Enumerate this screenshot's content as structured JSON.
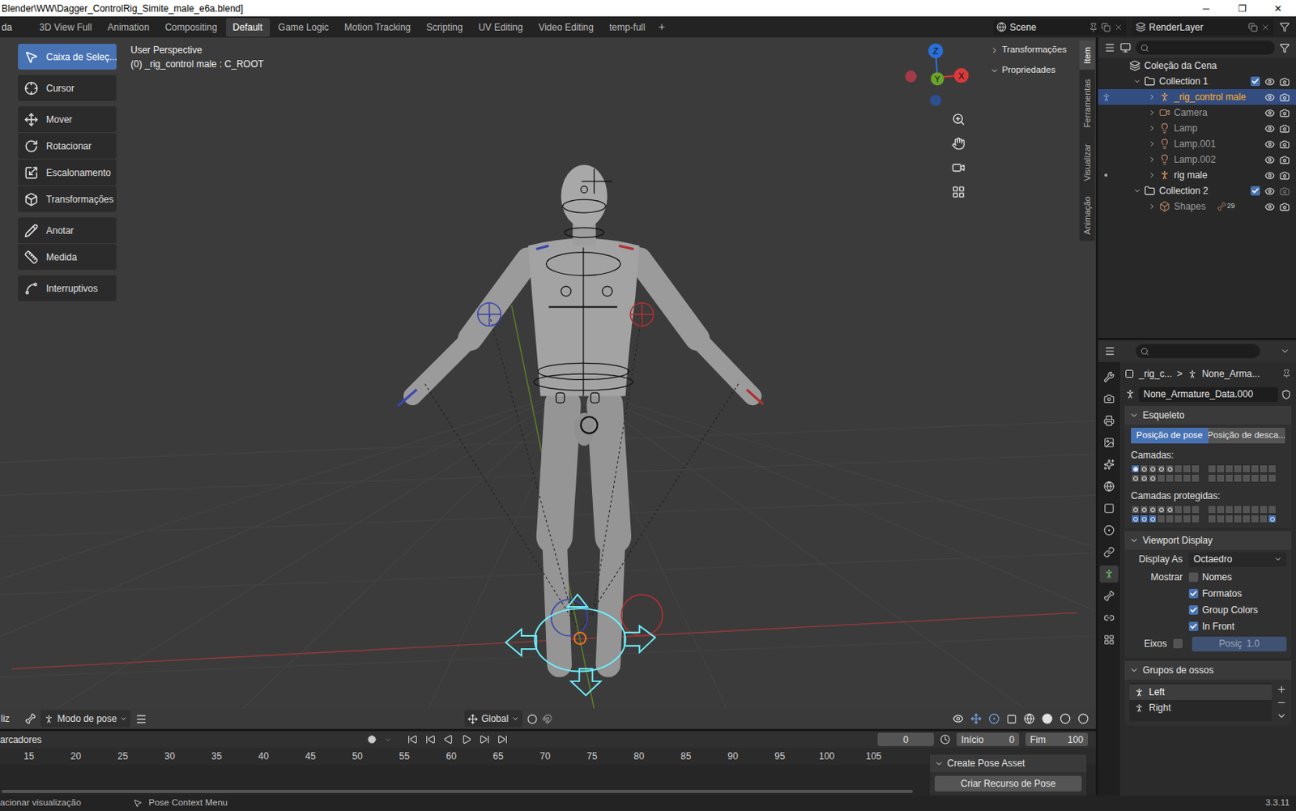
{
  "window": {
    "title": "Blender\\WW\\Dagger_ControlRig_Simite_male_e6a.blend]",
    "controls": [
      "─",
      "❐",
      "✕"
    ]
  },
  "menu_cut": "da",
  "workspaces": [
    {
      "label": "3D View Full",
      "selected": false
    },
    {
      "label": "Animation",
      "selected": false
    },
    {
      "label": "Compositing",
      "selected": false
    },
    {
      "label": "Default",
      "selected": true
    },
    {
      "label": "Game Logic",
      "selected": false
    },
    {
      "label": "Motion Tracking",
      "selected": false
    },
    {
      "label": "Scripting",
      "selected": false
    },
    {
      "label": "UV Editing",
      "selected": false
    },
    {
      "label": "Video Editing",
      "selected": false
    },
    {
      "label": "temp-full",
      "selected": false
    }
  ],
  "add_tab": "+",
  "scene": "Scene",
  "view_layer": "RenderLayer",
  "toolbar": [
    {
      "label": "Caixa de Seleç...",
      "selected": true
    },
    {
      "label": "Cursor",
      "selected": false
    },
    {
      "label": "Mover",
      "selected": false
    },
    {
      "label": "Rotacionar",
      "selected": false
    },
    {
      "label": "Escalonamento",
      "selected": false
    },
    {
      "label": "Transformações",
      "selected": false
    },
    {
      "label": "Anotar",
      "selected": false
    },
    {
      "label": "Medida",
      "selected": false
    },
    {
      "label": "Interruptivos",
      "selected": false
    }
  ],
  "viewport": {
    "view": "User Perspective",
    "object": "(0) _rig_control male : C_ROOT",
    "axes": {
      "x": "X",
      "y": "Y",
      "z": "Z"
    }
  },
  "sidebar_tabs": [
    {
      "label": "Item",
      "selected": true
    },
    {
      "label": "Ferramentas",
      "selected": false
    },
    {
      "label": "Visualizar",
      "selected": false
    },
    {
      "label": "Animação",
      "selected": false
    }
  ],
  "sidebar_panels": [
    {
      "label": "Transformações",
      "expanded": false
    },
    {
      "label": "Propriedades",
      "expanded": true
    }
  ],
  "viewport_header": {
    "cut": "liz",
    "mode": "Modo de pose",
    "orientation": "Global"
  },
  "outliner": [
    {
      "label": "Coleção da Cena",
      "depth": 0,
      "kind": "scene",
      "selected": false,
      "dimmed": false,
      "marker": "none"
    },
    {
      "label": "Collection 1",
      "depth": 1,
      "kind": "collection",
      "selected": false,
      "dimmed": false,
      "marker": "none",
      "expanded": true,
      "checked": true,
      "visible": true,
      "renderable": true
    },
    {
      "label": "_rig_control male",
      "depth": 2,
      "kind": "armature",
      "selected": true,
      "dimmed": false,
      "marker": "pose",
      "expanded": false,
      "visible": true,
      "renderable": true
    },
    {
      "label": "Camera",
      "depth": 2,
      "kind": "camera",
      "selected": false,
      "dimmed": true,
      "marker": "none",
      "expanded": false,
      "visible": true,
      "renderable": true
    },
    {
      "label": "Lamp",
      "depth": 2,
      "kind": "light",
      "selected": false,
      "dimmed": true,
      "marker": "none",
      "expanded": false,
      "visible": true,
      "renderable": true
    },
    {
      "label": "Lamp.001",
      "depth": 2,
      "kind": "light",
      "selected": false,
      "dimmed": true,
      "marker": "none",
      "expanded": false,
      "visible": true,
      "renderable": true
    },
    {
      "label": "Lamp.002",
      "depth": 2,
      "kind": "light",
      "selected": false,
      "dimmed": true,
      "marker": "none",
      "expanded": false,
      "visible": true,
      "renderable": true
    },
    {
      "label": "rig male",
      "depth": 2,
      "kind": "armature",
      "selected": false,
      "dimmed": false,
      "marker": "dot",
      "expanded": false,
      "visible": true,
      "renderable": true
    },
    {
      "label": "Collection 2",
      "depth": 1,
      "kind": "collection",
      "selected": false,
      "dimmed": false,
      "marker": "none",
      "expanded": true,
      "checked": true,
      "visible": true,
      "renderable": false
    },
    {
      "label": "Shapes",
      "depth": 2,
      "kind": "empty",
      "selected": false,
      "dimmed": true,
      "marker": "none",
      "expanded": false,
      "visible": true,
      "renderable": true,
      "badge": "29"
    }
  ],
  "properties_tabs": [
    {
      "selected": false
    },
    {
      "selected": false
    },
    {
      "selected": false
    },
    {
      "selected": false
    },
    {
      "selected": false
    },
    {
      "selected": false
    },
    {
      "selected": false
    },
    {
      "selected": false
    },
    {
      "selected": false
    },
    {
      "selected": true
    },
    {
      "selected": false
    },
    {
      "selected": false
    },
    {
      "selected": false
    }
  ],
  "properties": {
    "breadcrumb": [
      "_rig_c...",
      ">",
      "None_Arma..."
    ],
    "data_name": "None_Armature_Data.000",
    "skeleton": {
      "title": "Esqueleto",
      "expanded": true,
      "positions": [
        {
          "label": "Posição de pose",
          "selected": true
        },
        {
          "label": "Posição de desca...",
          "selected": false
        }
      ],
      "layers": {
        "label": "Camadas:",
        "rows": [
          [
            {
              "dot": true,
              "selected": true
            },
            {
              "dot": true,
              "selected": false
            },
            {
              "dot": true,
              "selected": false
            },
            {
              "dot": true,
              "selected": false
            },
            {
              "dot": true,
              "selected": false
            },
            {
              "dot": false,
              "selected": false
            },
            {
              "dot": false,
              "selected": false
            },
            {
              "dot": false,
              "selected": false
            },
            {
              "dot": false,
              "selected": false
            },
            {
              "dot": false,
              "selected": false
            },
            {
              "dot": false,
              "selected": false
            },
            {
              "dot": false,
              "selected": false
            },
            {
              "dot": false,
              "selected": false
            },
            {
              "dot": false,
              "selected": false
            },
            {
              "dot": false,
              "selected": false
            },
            {
              "dot": false,
              "selected": false
            }
          ],
          [
            {
              "dot": true,
              "selected": false
            },
            {
              "dot": true,
              "selected": false
            },
            {
              "dot": true,
              "selected": false
            },
            {
              "dot": false,
              "selected": false
            },
            {
              "dot": false,
              "selected": false
            },
            {
              "dot": false,
              "selected": false
            },
            {
              "dot": false,
              "selected": false
            },
            {
              "dot": false,
              "selected": false
            },
            {
              "dot": false,
              "selected": false
            },
            {
              "dot": false,
              "selected": false
            },
            {
              "dot": false,
              "selected": false
            },
            {
              "dot": false,
              "selected": false
            },
            {
              "dot": false,
              "selected": false
            },
            {
              "dot": false,
              "selected": false
            },
            {
              "dot": false,
              "selected": false
            },
            {
              "dot": false,
              "selected": false
            }
          ]
        ]
      },
      "protected": {
        "label": "Camadas protegidas:",
        "rows": [
          [
            {
              "dot": true,
              "selected": false
            },
            {
              "dot": true,
              "selected": false
            },
            {
              "dot": true,
              "selected": false
            },
            {
              "dot": true,
              "selected": false
            },
            {
              "dot": true,
              "selected": false
            },
            {
              "dot": false,
              "selected": false
            },
            {
              "dot": false,
              "selected": false
            },
            {
              "dot": false,
              "selected": false
            },
            {
              "dot": false,
              "selected": false
            },
            {
              "dot": false,
              "selected": false
            },
            {
              "dot": false,
              "selected": false
            },
            {
              "dot": false,
              "selected": false
            },
            {
              "dot": false,
              "selected": false
            },
            {
              "dot": false,
              "selected": false
            },
            {
              "dot": false,
              "selected": false
            },
            {
              "dot": false,
              "selected": false
            }
          ],
          [
            {
              "dot": true,
              "selected": true
            },
            {
              "dot": true,
              "selected": true
            },
            {
              "dot": true,
              "selected": true
            },
            {
              "dot": false,
              "selected": false
            },
            {
              "dot": false,
              "selected": false
            },
            {
              "dot": false,
              "selected": false
            },
            {
              "dot": false,
              "selected": false
            },
            {
              "dot": false,
              "selected": false
            },
            {
              "dot": false,
              "selected": false
            },
            {
              "dot": false,
              "selected": false
            },
            {
              "dot": false,
              "selected": false
            },
            {
              "dot": false,
              "selected": false
            },
            {
              "dot": false,
              "selected": false
            },
            {
              "dot": false,
              "selected": false
            },
            {
              "dot": false,
              "selected": false
            },
            {
              "dot": true,
              "selected": true
            }
          ]
        ]
      }
    },
    "display": {
      "title": "Viewport Display",
      "expanded": true,
      "display_as_label": "Display As",
      "display_as": "Octaedro",
      "show_label": "Mostrar",
      "options": [
        {
          "label": "Nomes",
          "checked": false
        },
        {
          "label": "Formatos",
          "checked": true
        },
        {
          "label": "Group Colors",
          "checked": true
        },
        {
          "label": "In Front",
          "checked": true
        }
      ],
      "axes_label": "Eixos",
      "axes_checked": false,
      "axes_position": "Posiç",
      "axes_value": "1.0",
      "axes_disabled": true
    },
    "bone_groups": {
      "title": "Grupos de ossos",
      "expanded": true,
      "items": [
        {
          "label": "Left",
          "selected": true
        },
        {
          "label": "Right",
          "selected": false
        }
      ]
    }
  },
  "timeline": {
    "label": "arcadores",
    "frame": "0",
    "start_label": "Início",
    "start": "0",
    "end_label": "Fim",
    "end": "100",
    "ruler": [
      "15",
      "20",
      "25",
      "30",
      "35",
      "40",
      "45",
      "50",
      "55",
      "60",
      "65",
      "70",
      "75",
      "80",
      "85",
      "90",
      "95",
      "100",
      "105"
    ]
  },
  "pose_asset": {
    "title": "Create Pose Asset",
    "button": "Criar Recurso de Pose"
  },
  "status": {
    "left": "acionar visualização",
    "middle": "Pose Context Menu",
    "version": "3.3.11"
  }
}
